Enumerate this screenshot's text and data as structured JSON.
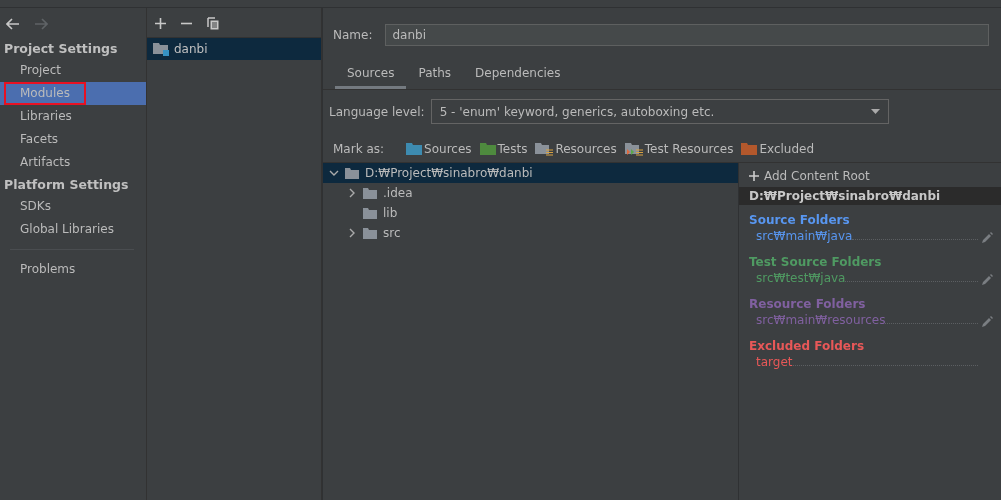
{
  "nav": {
    "back_enabled": true,
    "forward_enabled": false
  },
  "sidebar": {
    "sections": [
      {
        "title": "Project Settings",
        "items": [
          {
            "label": "Project",
            "selected": false,
            "highlighted": false
          },
          {
            "label": "Modules",
            "selected": true,
            "highlighted": true
          },
          {
            "label": "Libraries",
            "selected": false,
            "highlighted": false
          },
          {
            "label": "Facets",
            "selected": false,
            "highlighted": false
          },
          {
            "label": "Artifacts",
            "selected": false,
            "highlighted": false
          }
        ]
      },
      {
        "title": "Platform Settings",
        "items": [
          {
            "label": "SDKs",
            "selected": false,
            "highlighted": false
          },
          {
            "label": "Global Libraries",
            "selected": false,
            "highlighted": false
          }
        ]
      }
    ],
    "footer_items": [
      {
        "label": "Problems",
        "selected": false
      }
    ]
  },
  "modules": {
    "items": [
      {
        "label": "danbi",
        "selected": true
      }
    ]
  },
  "name_field": {
    "label": "Name:",
    "value": "danbi"
  },
  "tabs": [
    {
      "label": "Sources",
      "selected": true
    },
    {
      "label": "Paths",
      "selected": false
    },
    {
      "label": "Dependencies",
      "selected": false
    }
  ],
  "language_level": {
    "label": "Language level:",
    "value": "5 - 'enum' keyword, generics, autoboxing etc."
  },
  "mark_as": {
    "label": "Mark as:",
    "buttons": [
      {
        "label": "Sources",
        "kind": "sources"
      },
      {
        "label": "Tests",
        "kind": "tests"
      },
      {
        "label": "Resources",
        "kind": "resources"
      },
      {
        "label": "Test Resources",
        "kind": "test_resources"
      },
      {
        "label": "Excluded",
        "kind": "excluded"
      }
    ]
  },
  "tree": [
    {
      "label": "D:₩Project₩sinabro₩danbi",
      "expanded": true,
      "selected": true,
      "children": [
        {
          "label": ".idea",
          "expanded": false,
          "selected": false,
          "has_children": true
        },
        {
          "label": "lib",
          "selected": false,
          "has_children": false
        },
        {
          "label": "src",
          "expanded": false,
          "selected": false,
          "has_children": true
        }
      ]
    }
  ],
  "content_root": {
    "add_label": "Add Content Root",
    "path": "D:₩Project₩sinabro₩danbi",
    "groups": [
      {
        "title": "Source Folders",
        "color": "#5896f0",
        "folders": [
          "src₩main₩java"
        ],
        "editable": true
      },
      {
        "title": "Test Source Folders",
        "color": "#4f9a62",
        "folders": [
          "src₩test₩java"
        ],
        "editable": true
      },
      {
        "title": "Resource Folders",
        "color": "#8060a0",
        "folders": [
          "src₩main₩resources"
        ],
        "editable": true
      },
      {
        "title": "Excluded Folders",
        "color": "#e85858",
        "folders": [
          "target"
        ],
        "editable": false
      }
    ]
  }
}
